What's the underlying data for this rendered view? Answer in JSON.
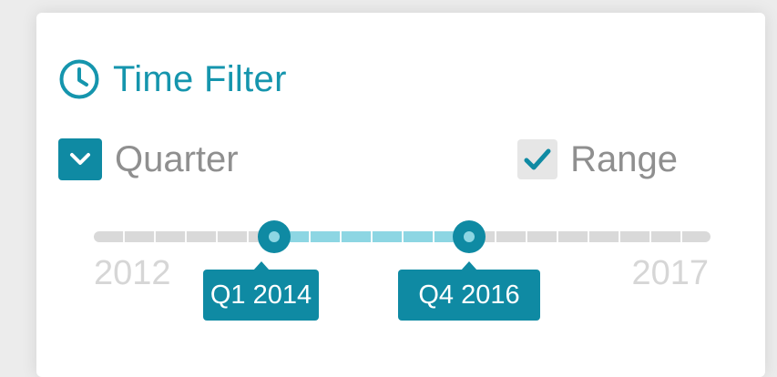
{
  "panel": {
    "title": "Time Filter",
    "title_icon": "clock-icon",
    "accent_color": "#0f8aa3"
  },
  "options": {
    "quarter": {
      "label": "Quarter",
      "icon": "chevron-down-icon"
    },
    "range": {
      "label": "Range",
      "icon": "checkmark-icon",
      "checked": true
    }
  },
  "slider": {
    "min_label": "2012",
    "max_label": "2017",
    "start_value": "Q1 2014",
    "end_value": "Q4 2016",
    "track_color": "#d9d9d9",
    "fill_color": "#8dd6e3"
  }
}
